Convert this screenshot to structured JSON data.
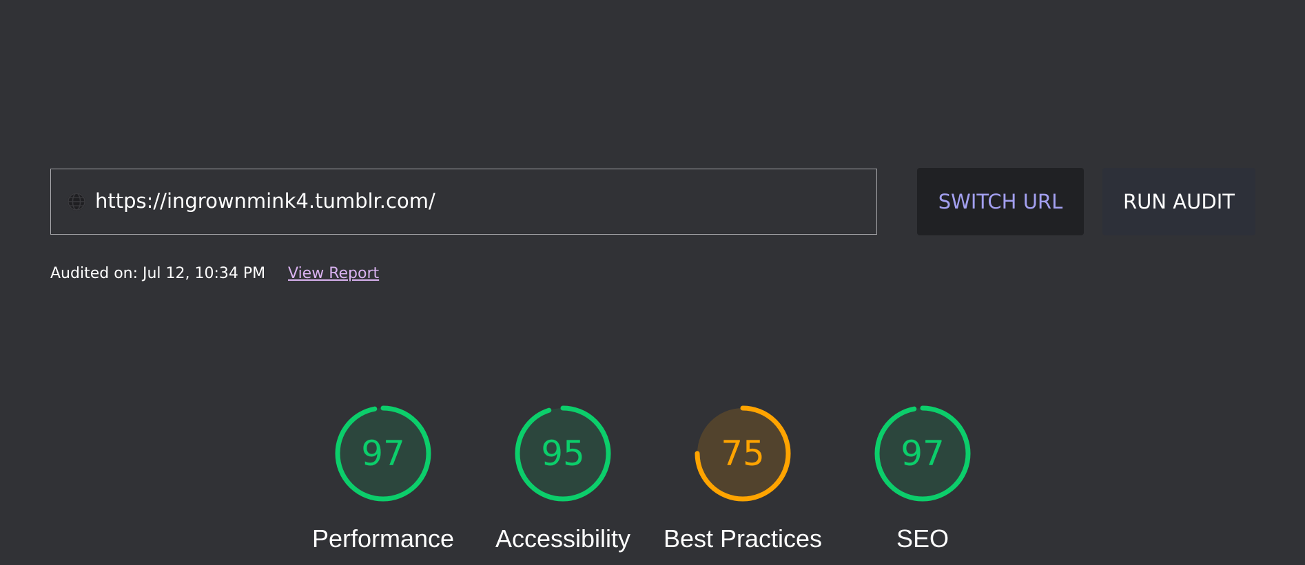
{
  "url_input": {
    "value": "https://ingrownmink4.tumblr.com/",
    "icon": "globe-icon"
  },
  "buttons": {
    "switch_url": "SWITCH URL",
    "run_audit": "RUN AUDIT"
  },
  "audit_info": {
    "audited_on": "Audited on: Jul 12, 10:34 PM",
    "view_report": "View Report"
  },
  "colors": {
    "background": "#313236",
    "pass": "#0cce6b",
    "average": "#ffa400",
    "link": "#d9b2f0",
    "switch_text": "#a3a0f0"
  },
  "scores": [
    {
      "label": "Performance",
      "score": 97,
      "status": "pass"
    },
    {
      "label": "Accessibility",
      "score": 95,
      "status": "pass"
    },
    {
      "label": "Best Practices",
      "score": 75,
      "status": "average"
    },
    {
      "label": "SEO",
      "score": 97,
      "status": "pass"
    }
  ]
}
